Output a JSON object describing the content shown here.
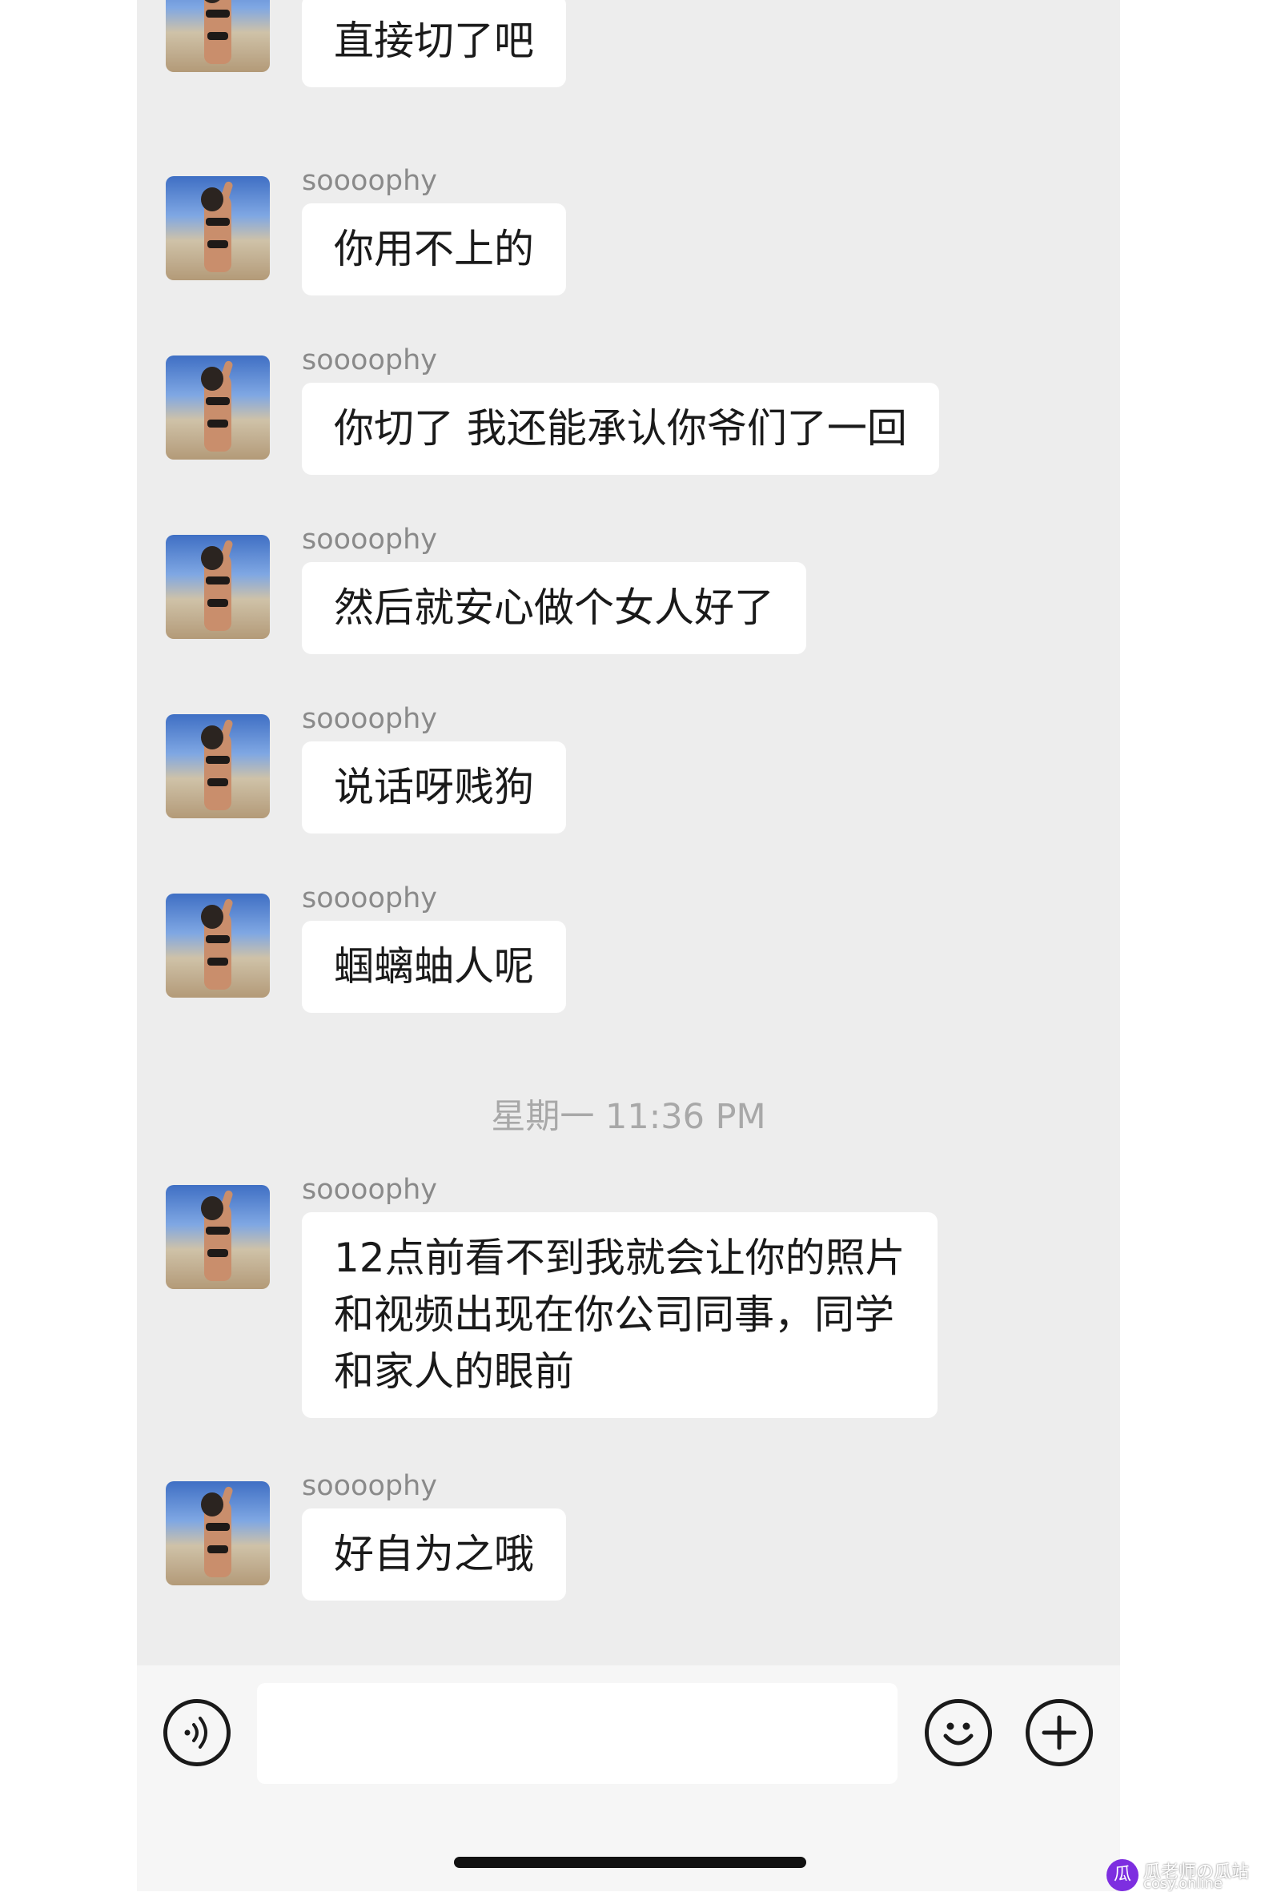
{
  "messages": [
    {
      "sender": "soooophy",
      "text": "直接切了吧"
    },
    {
      "sender": "soooophy",
      "text": "你用不上的"
    },
    {
      "sender": "soooophy",
      "text": "你切了 我还能承认你爷们了一回"
    },
    {
      "sender": "soooophy",
      "text": "然后就安心做个女人好了"
    },
    {
      "sender": "soooophy",
      "text": "说话呀贱狗"
    },
    {
      "sender": "soooophy",
      "text": "蝈螭蚰人呢"
    },
    {
      "sender": "soooophy",
      "text": "12点前看不到我就会让你的照片\n和视频出现在你公司同事，同学\n和家人的眼前"
    },
    {
      "sender": "soooophy",
      "text": "好自为之哦"
    }
  ],
  "timestamp": "星期一 11:36 PM",
  "input_bar": {
    "voice_icon": "voice-icon",
    "emoji_icon": "emoji-icon",
    "plus_icon": "plus-icon",
    "input_value": ""
  },
  "watermark": {
    "line1": "瓜老师の瓜站",
    "line2": "cosy.online"
  },
  "colors": {
    "background": "#ededed",
    "bubble": "#ffffff",
    "sender": "#8a8a8a"
  }
}
